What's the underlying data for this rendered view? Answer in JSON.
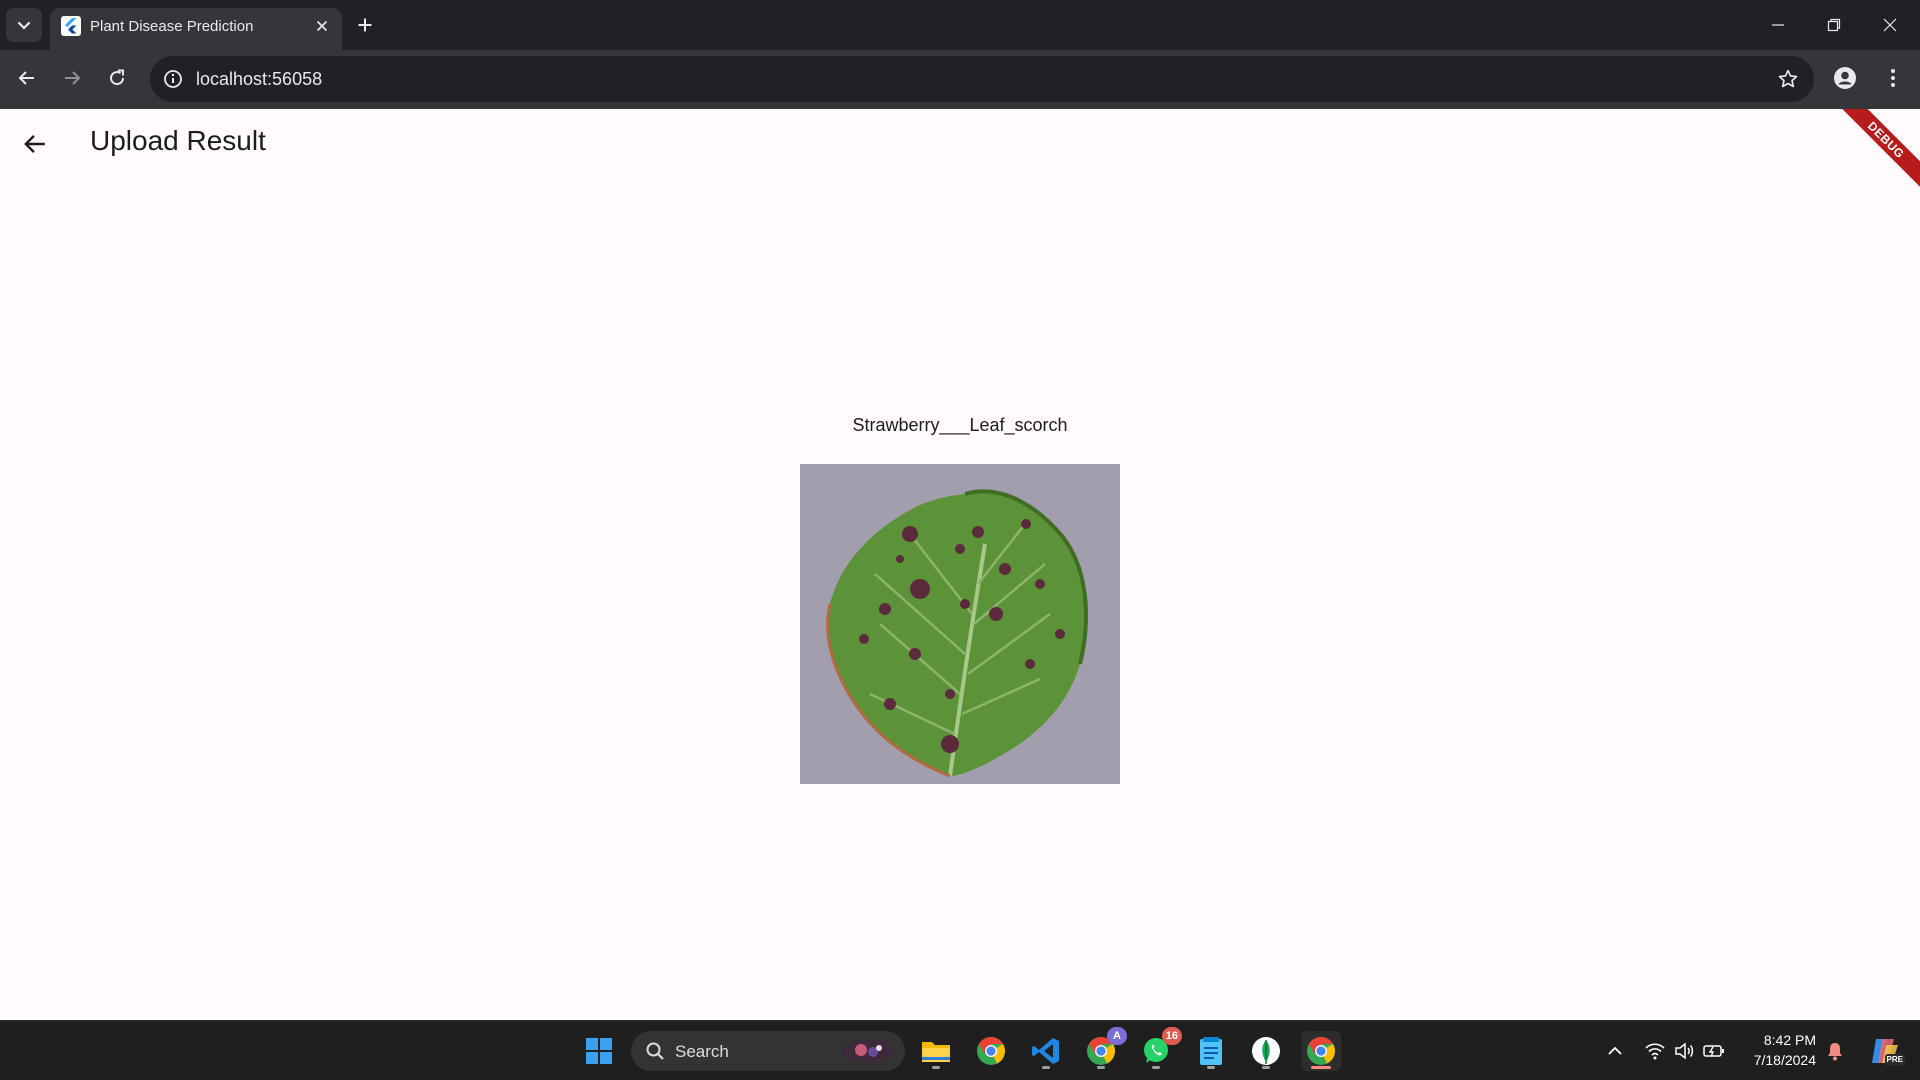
{
  "browser": {
    "tab_title": "Plant Disease Prediction",
    "url": "localhost:56058"
  },
  "app": {
    "title": "Upload Result",
    "debug_banner": "DEBUG",
    "prediction_label": "Strawberry___Leaf_scorch"
  },
  "taskbar": {
    "search_label": "Search",
    "whatsapp_badge": "16",
    "chrome_profile_badge": "A",
    "time": "8:42 PM",
    "date": "7/18/2024",
    "copilot_badge": "PRE"
  },
  "colors": {
    "chrome_dark": "#202124",
    "toolbar": "#35363a",
    "app_background": "#fffbfe",
    "debug_banner": "#b71c1c",
    "taskbar": "#1f1f1f"
  },
  "icons": {
    "tab_search": "chevron-down-icon",
    "favicon": "flutter-logo-icon",
    "back": "arrow-left-icon",
    "forward": "arrow-right-icon",
    "reload": "reload-icon",
    "site_info": "info-icon",
    "bookmark": "star-icon",
    "profile": "person-icon",
    "menu": "kebab-menu-icon"
  }
}
